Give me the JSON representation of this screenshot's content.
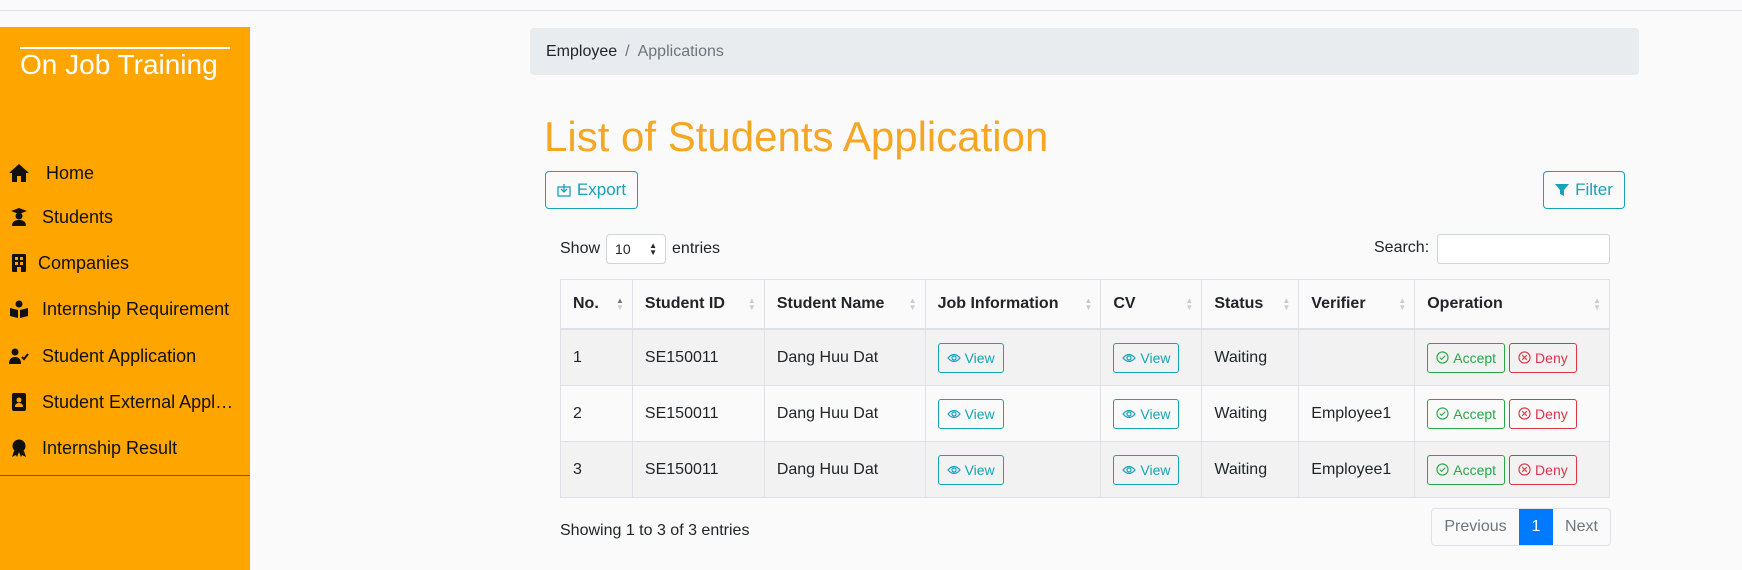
{
  "sidebar": {
    "brand": "On Job Training",
    "items": [
      {
        "label": "Home",
        "icon": "home-icon"
      },
      {
        "label": "Students",
        "icon": "graduate-icon"
      },
      {
        "label": "Companies",
        "icon": "building-icon"
      },
      {
        "label": "Internship Requirement",
        "icon": "book-reader-icon"
      },
      {
        "label": "Student Application",
        "icon": "user-check-icon"
      },
      {
        "label": "Student External Application",
        "icon": "id-badge-icon"
      },
      {
        "label": "Internship Result",
        "icon": "award-icon"
      }
    ]
  },
  "breadcrumb": {
    "home": "Employee",
    "separator": "/",
    "current": "Applications"
  },
  "page": {
    "title": "List of Students Application",
    "export_label": "Export",
    "filter_label": "Filter"
  },
  "table_controls": {
    "show_label": "Show",
    "entries_value": "10",
    "entries_label": "entries",
    "search_label": "Search:",
    "search_value": ""
  },
  "table": {
    "columns": [
      "No.",
      "Student ID",
      "Student Name",
      "Job Information",
      "CV",
      "Status",
      "Verifier",
      "Operation"
    ],
    "rows": [
      {
        "no": "1",
        "student_id": "SE150011",
        "student_name": "Dang Huu Dat",
        "job_view": "View",
        "cv_view": "View",
        "status": "Waiting",
        "verifier": "",
        "accept": "Accept",
        "deny": "Deny"
      },
      {
        "no": "2",
        "student_id": "SE150011",
        "student_name": "Dang Huu Dat",
        "job_view": "View",
        "cv_view": "View",
        "status": "Waiting",
        "verifier": "Employee1",
        "accept": "Accept",
        "deny": "Deny"
      },
      {
        "no": "3",
        "student_id": "SE150011",
        "student_name": "Dang Huu Dat",
        "job_view": "View",
        "cv_view": "View",
        "status": "Waiting",
        "verifier": "Employee1",
        "accept": "Accept",
        "deny": "Deny"
      }
    ]
  },
  "footer": {
    "info": "Showing 1 to 3 of 3 entries",
    "previous": "Previous",
    "current_page": "1",
    "next": "Next"
  },
  "colors": {
    "sidebar_bg": "#ffa500",
    "title": "#f5a623",
    "info": "#17a2b8",
    "success": "#28a745",
    "danger": "#dc3545",
    "primary": "#007bff"
  }
}
